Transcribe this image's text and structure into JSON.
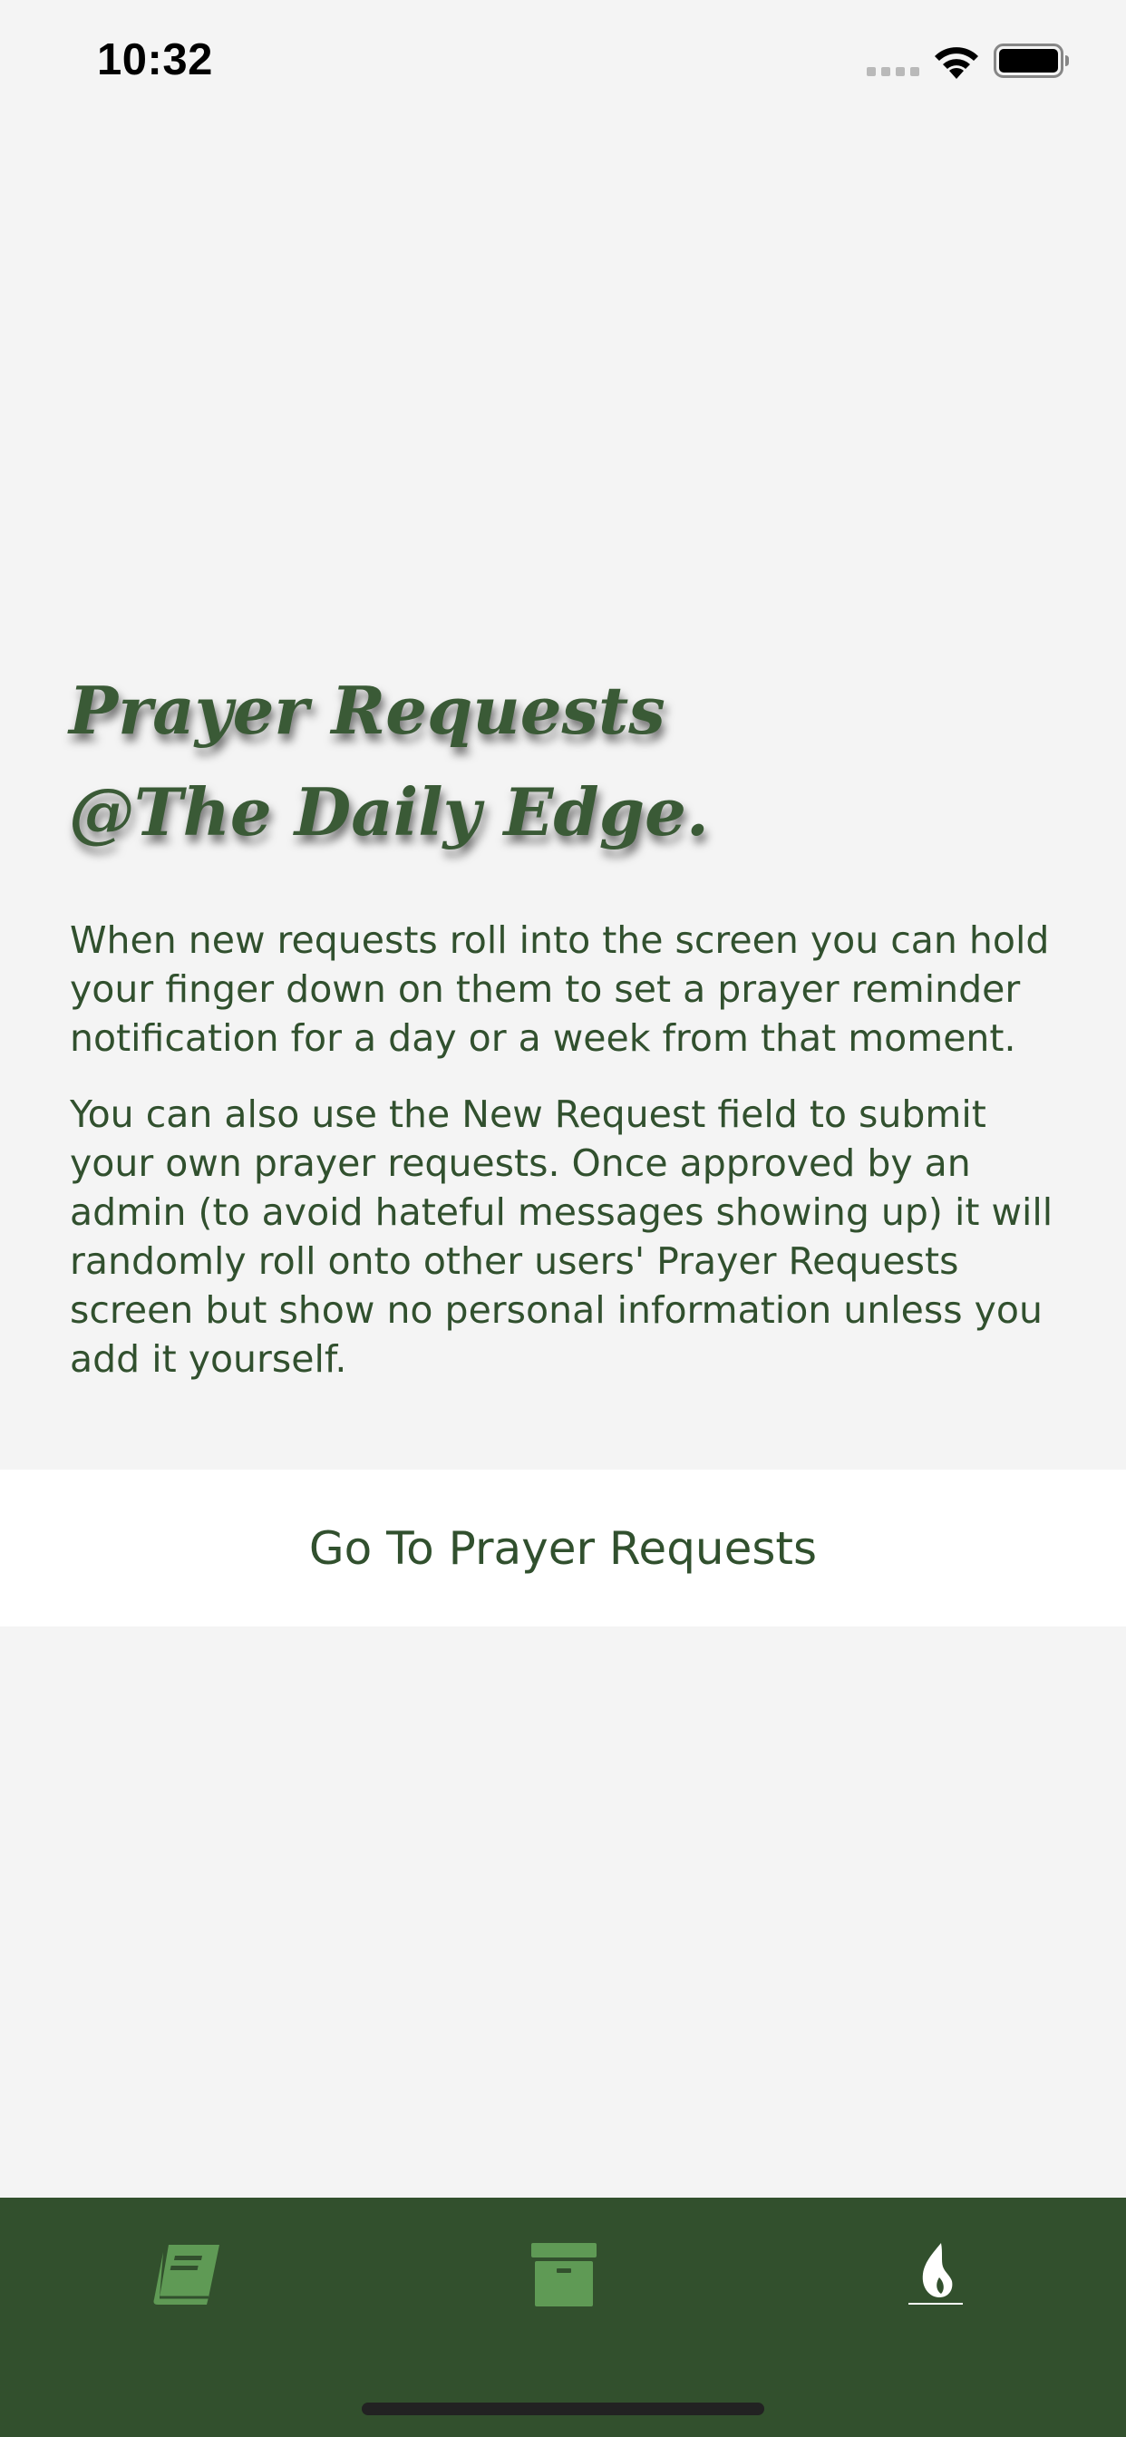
{
  "status_bar": {
    "time": "10:32",
    "icons": [
      "signal-icon",
      "wifi-icon",
      "battery-icon"
    ]
  },
  "heading": {
    "line1": "Prayer Requests",
    "line2": "@The Daily Edge."
  },
  "intro": {
    "paragraph1": [
      "When new requests roll into the screen you can hold",
      "your finger down on them to set a prayer reminder",
      "notification for a day or a week from that moment."
    ],
    "paragraph2": [
      "You can also use the New Request field to submit",
      "your own prayer requests.  Once approved by an",
      "admin (to avoid hateful messages showing up) it will",
      "randomly roll onto other users' Prayer Requests",
      "screen but show no personal information unless you",
      "add it yourself."
    ]
  },
  "cta": {
    "label": "Go To Prayer Requests"
  },
  "tab_bar": {
    "tabs": [
      {
        "icon": "book-icon",
        "active": false
      },
      {
        "icon": "archive-box-icon",
        "active": false
      },
      {
        "icon": "flame-icon",
        "active": true
      }
    ]
  },
  "colors": {
    "background": "#f4f4f4",
    "text": "#31502e",
    "tab_bar": "#32502d",
    "tab_icon_inactive": "#5f9a55",
    "tab_icon_active": "#ffffff"
  }
}
